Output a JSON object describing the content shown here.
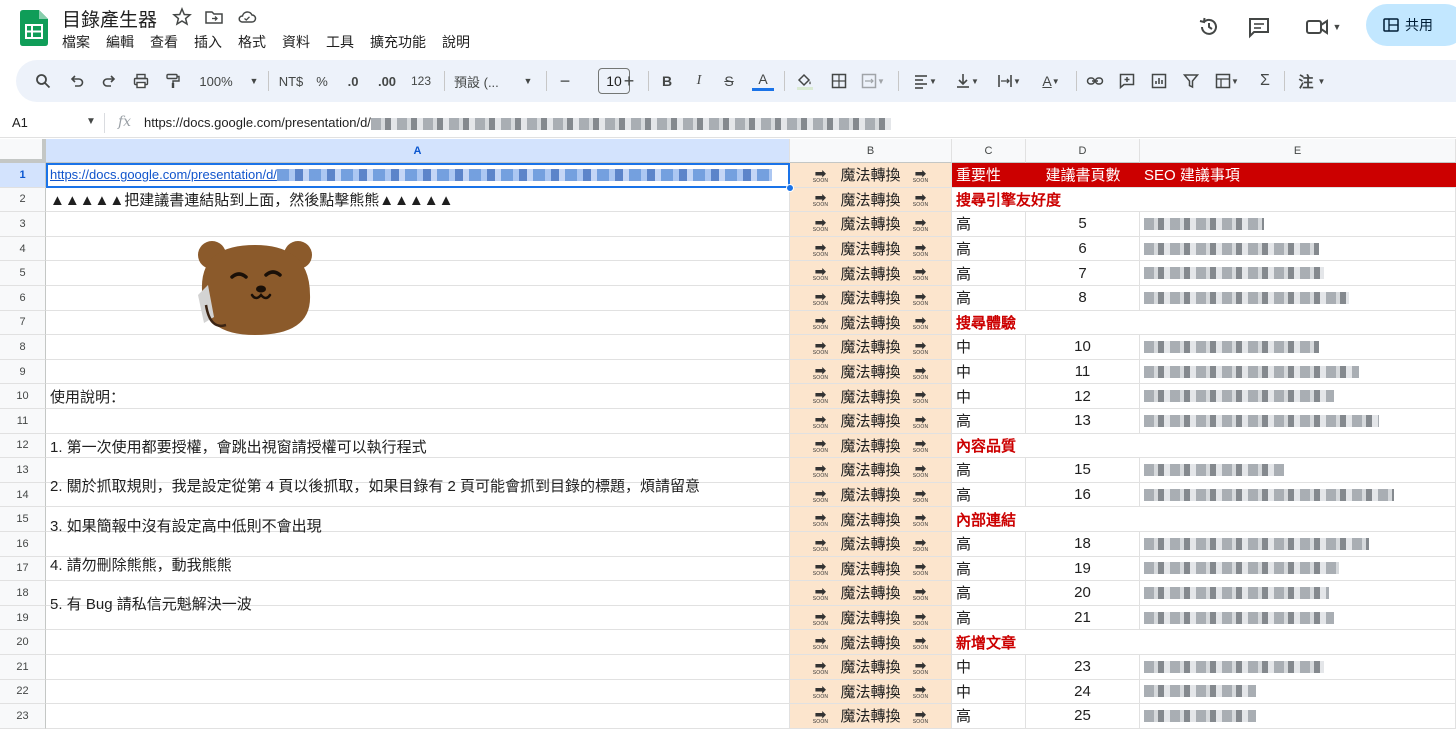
{
  "app": {
    "title": "目錄產生器",
    "menus": [
      "檔案",
      "編輯",
      "查看",
      "插入",
      "格式",
      "資料",
      "工具",
      "擴充功能",
      "說明"
    ],
    "share_label": "共用",
    "colors": {
      "accent": "#1a73e8",
      "share_bg": "#c2e7ff",
      "header_red": "#cc0000",
      "magic_bg": "#fce5cd",
      "logo_green": "#0f9d58"
    }
  },
  "toolbar": {
    "zoom": "100%",
    "currency": "NT$",
    "percent": "%",
    "decrease_decimal": ".0",
    "increase_decimal": ".00",
    "number_format": "123",
    "font": "預設 (...",
    "font_size": "10",
    "bold": "B",
    "italic": "I",
    "strike": "S",
    "text_color": "A",
    "sum": "Σ",
    "input_tools": "注"
  },
  "formula_bar": {
    "name_box": "A1",
    "fx": "fx",
    "text": "https://docs.google.com/presentation/d/"
  },
  "columns": [
    "A",
    "B",
    "C",
    "D",
    "E"
  ],
  "rows": [
    "1",
    "2",
    "3",
    "4",
    "5",
    "6",
    "7",
    "8",
    "9",
    "10",
    "11",
    "12",
    "13",
    "14",
    "15",
    "16",
    "17",
    "18",
    "19",
    "20",
    "21",
    "22",
    "23"
  ],
  "col_a": {
    "url": "https://docs.google.com/presentation/d/",
    "instruction": "▲▲▲▲▲把建議書連結貼到上面，然後點擊熊熊▲▲▲▲▲",
    "usage_title": "使用說明：",
    "notes": [
      "1. 第一次使用都要授權，會跳出視窗請授權可以執行程式",
      "2. 關於抓取規則，我是設定從第 4 頁以後抓取，如果目錄有 2 頁可能會抓到目錄的標題，煩請留意",
      "3. 如果簡報中沒有設定高中低則不會出現",
      "4. 請勿刪除熊熊，動我熊熊",
      "5. 有 Bug 請私信元魁解決一波"
    ]
  },
  "magic_label": "魔法轉換",
  "arrow_badge": "SOON",
  "header": {
    "c": "重要性",
    "d": "建議書頁數",
    "e": "SEO 建議事項"
  },
  "data_rows": [
    {
      "section": "搜尋引擎友好度"
    },
    {
      "c": "高",
      "d": "5"
    },
    {
      "c": "高",
      "d": "6"
    },
    {
      "c": "高",
      "d": "7"
    },
    {
      "c": "高",
      "d": "8"
    },
    {
      "section": "搜尋體驗"
    },
    {
      "c": "中",
      "d": "10"
    },
    {
      "c": "中",
      "d": "11"
    },
    {
      "c": "中",
      "d": "12"
    },
    {
      "c": "高",
      "d": "13"
    },
    {
      "section": "內容品質"
    },
    {
      "c": "高",
      "d": "15"
    },
    {
      "c": "高",
      "d": "16"
    },
    {
      "section": "內部連結"
    },
    {
      "c": "高",
      "d": "18"
    },
    {
      "c": "高",
      "d": "19"
    },
    {
      "c": "高",
      "d": "20"
    },
    {
      "c": "高",
      "d": "21"
    },
    {
      "section": "新增文章"
    },
    {
      "c": "中",
      "d": "23"
    },
    {
      "c": "中",
      "d": "24"
    },
    {
      "c": "高",
      "d": "25"
    }
  ]
}
